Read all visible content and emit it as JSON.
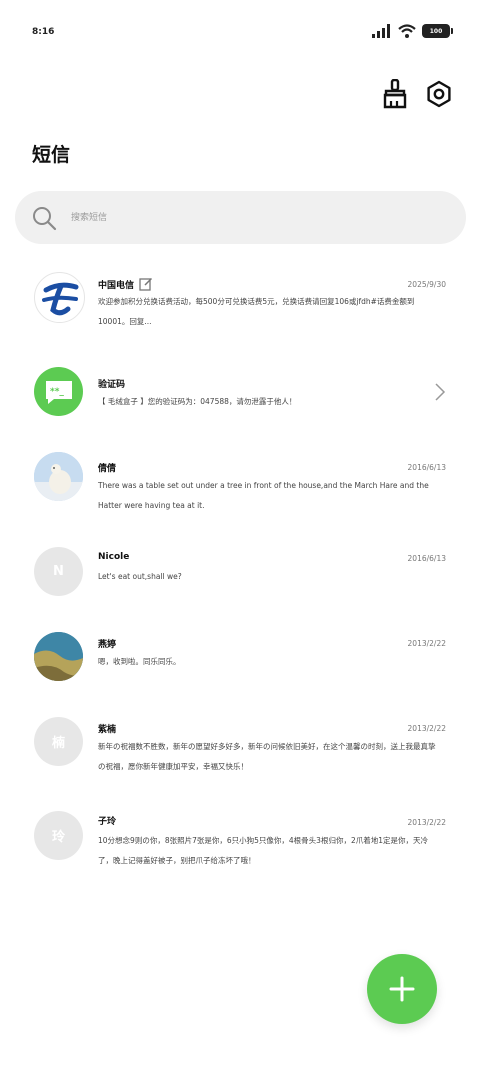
{
  "status_bar": {
    "time": "8:16",
    "battery": "100"
  },
  "header": {
    "title": "短信"
  },
  "search": {
    "placeholder": "搜索短信"
  },
  "messages": [
    {
      "name": "中国电信",
      "date": "2025/9/30",
      "preview": "欢迎参加积分兑换话费活动，每500分可兑换话费5元，兑换话费请回复106或jfdh#话费金额到10001。回复..."
    },
    {
      "name": "验证码",
      "date": "",
      "preview": "【 毛绒盒子 】您的验证码为：047588，请勿泄露于他人！"
    },
    {
      "name": "倩倩",
      "date": "2016/6/13",
      "preview": "There was a table set out under a tree in front of the house,and the March Hare and the Hatter were having tea at it."
    },
    {
      "name": "Nicole",
      "date": "2016/6/13",
      "preview": "Let's eat out,shall we?",
      "avatar_letter": "N"
    },
    {
      "name": "燕婷",
      "date": "2013/2/22",
      "preview": "嗯，收到啦。同乐同乐。"
    },
    {
      "name": "紫楠",
      "date": "2013/2/22",
      "preview": "新年の祝福数不胜数，新年の愿望好多好多，新年の问候依旧美好，在这个温馨の时刻，送上我最真挚の祝福，愿你新年健康加平安，幸福又快乐！",
      "avatar_letter": "楠"
    },
    {
      "name": "子玲",
      "date": "2013/2/22",
      "preview": "10分想念9则の你，8张照片7张是你，6只小狗5只像你，4根骨头3根归你，2爪着地1定是你，天冷了，晚上记得盖好被子，别把爪子给冻坏了哦！",
      "avatar_letter": "玲"
    }
  ],
  "colors": {
    "fab": "#5ccb52",
    "sms_avatar": "#5ccb52",
    "telecom_blue": "#1b4ea3",
    "search_bg": "#f0f0f0"
  },
  "icons": [
    "signal-icon",
    "wifi-icon",
    "battery-icon",
    "broom-icon",
    "settings-icon",
    "search-icon",
    "edit-icon",
    "chevron-right-icon",
    "plus-icon"
  ]
}
